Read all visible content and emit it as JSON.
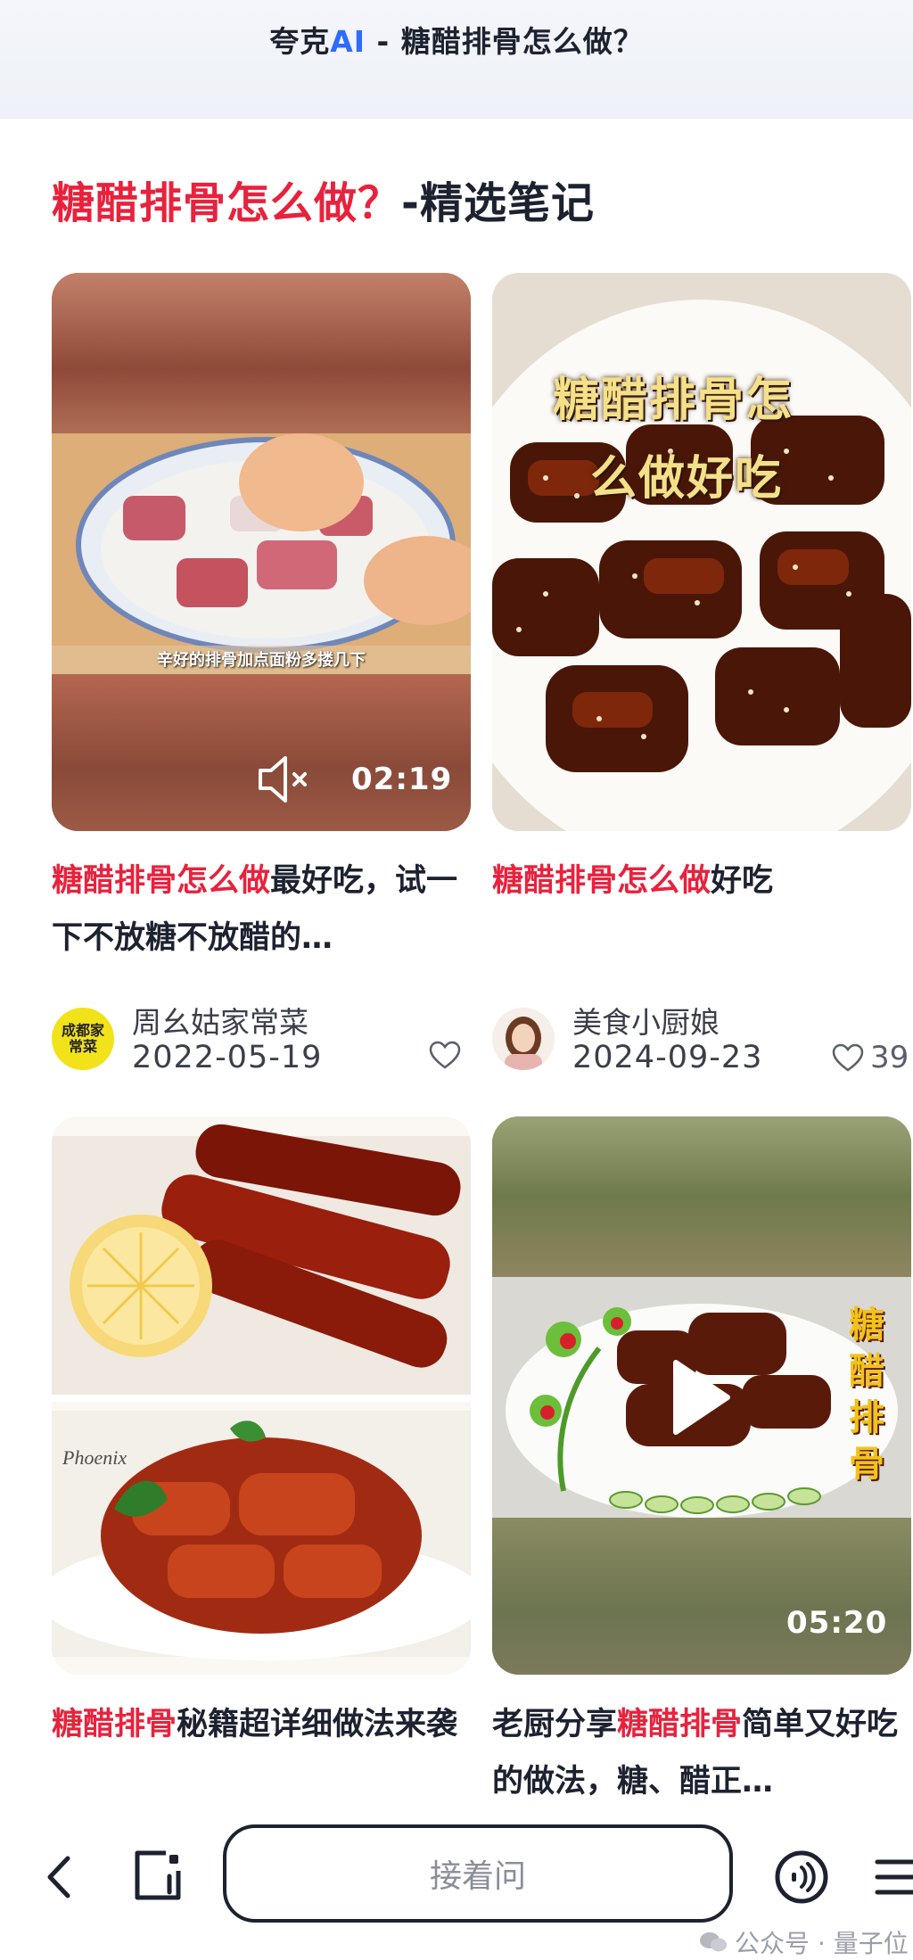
{
  "header": {
    "title_prefix": "夸克",
    "title_ai": "AI",
    "title_suffix": " - 糖醋排骨怎么做？"
  },
  "section": {
    "title_highlight": "糖醋排骨怎么做？",
    "title_rest": "-精选笔记"
  },
  "cards": [
    {
      "overlay_subtitle": "辛好的排骨加点面粉多搂几下",
      "duration": "02:19",
      "caption_highlight": "糖醋排骨怎么做",
      "caption_rest": "最好吃，试一下不放糖不放醋的…",
      "author": "周幺姑家常菜",
      "avatar_text": "成都家常菜",
      "date": "2022-05-19"
    },
    {
      "overlay_text_line1": "糖醋排骨怎",
      "overlay_text_line2": "么做好吃",
      "caption_highlight": "糖醋排骨怎么做",
      "caption_rest": "好吃",
      "author": "美食小厨娘",
      "date": "2024-09-23",
      "likes": "39"
    },
    {
      "caption_highlight": "糖醋排骨",
      "caption_rest": "秘籍超详细做法来袭",
      "plate_text": "Phoenix"
    },
    {
      "vertical_text": "糖醋排骨",
      "duration": "05:20",
      "caption_prefix": "老厨分享",
      "caption_highlight": "糖醋排骨",
      "caption_rest": "简单又好吃的做法，糖、醋正…"
    }
  ],
  "bottom_bar": {
    "ask_placeholder": "接着问"
  },
  "watermark": {
    "text": "公众号 · 量子位"
  },
  "colors": {
    "highlight": "#e8223d",
    "ai_blue": "#2f6bff",
    "text_dark": "#1d2230"
  }
}
